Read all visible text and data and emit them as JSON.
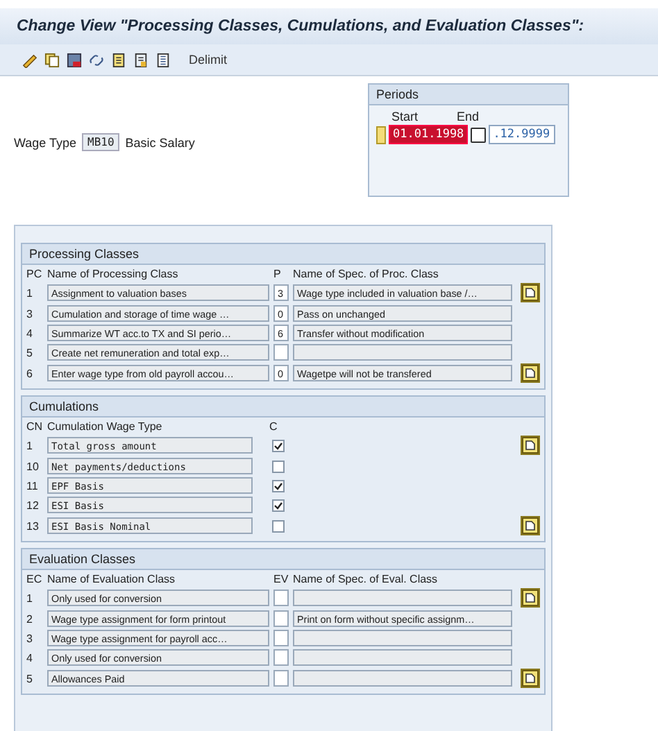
{
  "title": "Change View \"Processing Classes, Cumulations, and Evaluation Classes\":",
  "toolbar": {
    "button_label": "Delimit"
  },
  "wage_type": {
    "label": "Wage Type",
    "code": "MB10",
    "text": "Basic Salary"
  },
  "periods": {
    "title": "Periods",
    "start_label": "Start",
    "end_label": "End",
    "start": "01.01.1998",
    "start_invalid": true,
    "end": ".12.9999"
  },
  "processing_classes": {
    "title": "Processing Classes",
    "columns": [
      "PC",
      "Name of Processing Class",
      "P",
      "Name of Spec. of Proc. Class"
    ],
    "rows": [
      {
        "pc": "1",
        "name": "Assignment to valuation bases",
        "p": "3",
        "spec": "Wage type included in valuation base /…"
      },
      {
        "pc": "3",
        "name": "Cumulation and storage of time wage …",
        "p": "0",
        "spec": "Pass on unchanged"
      },
      {
        "pc": "4",
        "name": "Summarize WT acc.to TX and SI perio…",
        "p": "6",
        "spec": "Transfer without modification"
      },
      {
        "pc": "5",
        "name": "Create net remuneration and total exp…"
      },
      {
        "pc": "6",
        "name": "Enter wage type from old payroll accou…",
        "p": "0",
        "spec": "Wagetpe will not be transfered"
      }
    ]
  },
  "cumulations": {
    "title": "Cumulations",
    "columns": [
      "CN",
      "Cumulation Wage Type",
      "C"
    ],
    "rows": [
      {
        "cn": "1",
        "name": "Total gross amount",
        "checked": true
      },
      {
        "cn": "10",
        "name": "Net payments/deductions",
        "checked": false
      },
      {
        "cn": "11",
        "name": "EPF Basis",
        "checked": true
      },
      {
        "cn": "12",
        "name": "ESI Basis",
        "checked": true
      },
      {
        "cn": "13",
        "name": "ESI Basis Nominal",
        "checked": false
      }
    ]
  },
  "evaluation_classes": {
    "title": "Evaluation Classes",
    "columns": [
      "EC",
      "Name of Evaluation Class",
      "EV",
      "Name of Spec. of Eval. Class"
    ],
    "rows": [
      {
        "ec": "1",
        "name": "Only used for conversion"
      },
      {
        "ec": "2",
        "name": "Wage type assignment for form printout",
        "spec": "Print on form without specific assignm…"
      },
      {
        "ec": "3",
        "name": "Wage type assignment for payroll acc…"
      },
      {
        "ec": "4",
        "name": "Only used for conversion"
      },
      {
        "ec": "5",
        "name": "Allowances Paid"
      }
    ]
  }
}
